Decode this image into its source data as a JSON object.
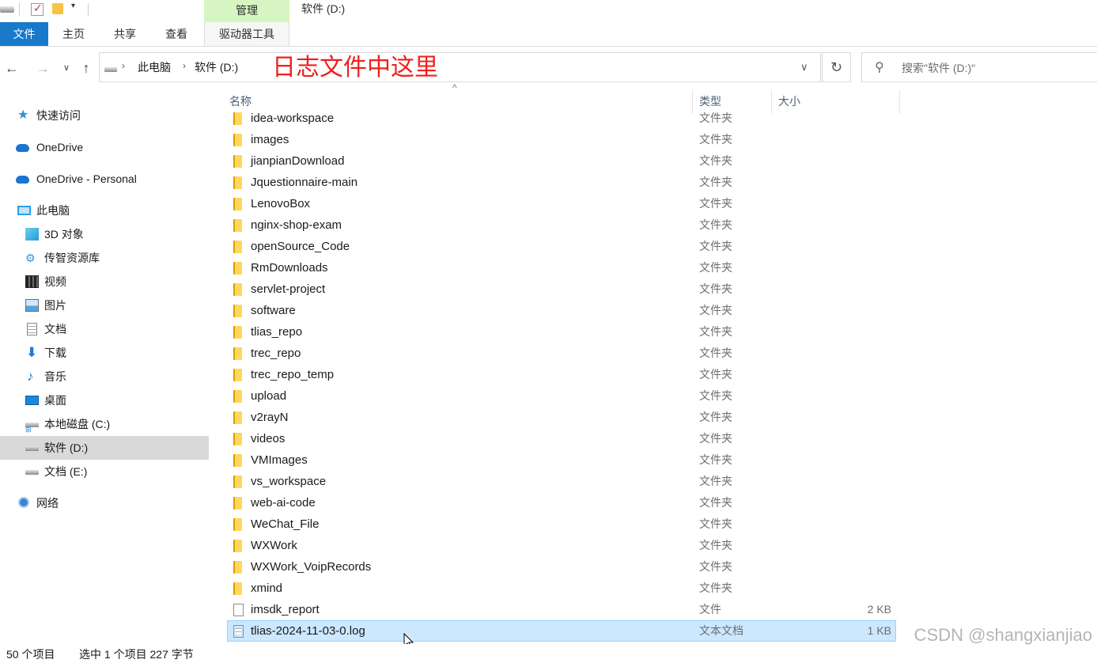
{
  "titlebar": {
    "manage_tab": "管理",
    "window_title": "软件 (D:)"
  },
  "ribbon": {
    "tabs": {
      "file": "文件",
      "home": "主页",
      "share": "共享",
      "view": "查看",
      "drive_tools": "驱动器工具"
    },
    "file_tab_color": "#1979ca",
    "manage_color": "#d6f5c2"
  },
  "address": {
    "crumbs": [
      "此电脑",
      "软件 (D:)"
    ],
    "annotation": "日志文件中这里",
    "annotation_color": "#f01e1e"
  },
  "search": {
    "placeholder": "搜索\"软件 (D:)\""
  },
  "navpane": {
    "items": [
      {
        "label": "快速访问",
        "icon": "star-icon"
      },
      {
        "label": "OneDrive",
        "icon": "onedrive-cloud-icon"
      },
      {
        "label": "OneDrive - Personal",
        "icon": "onedrive-cloud-icon"
      },
      {
        "label": "此电脑",
        "icon": "computer-icon"
      },
      {
        "label": "3D 对象",
        "icon": "3d-objects-icon"
      },
      {
        "label": "传智资源库",
        "icon": "network-share-icon"
      },
      {
        "label": "视频",
        "icon": "video-icon"
      },
      {
        "label": "图片",
        "icon": "pictures-icon"
      },
      {
        "label": "文档",
        "icon": "documents-icon"
      },
      {
        "label": "下载",
        "icon": "download-icon"
      },
      {
        "label": "音乐",
        "icon": "music-icon"
      },
      {
        "label": "桌面",
        "icon": "desktop-icon"
      },
      {
        "label": "本地磁盘 (C:)",
        "icon": "system-drive-icon"
      },
      {
        "label": "软件 (D:)",
        "icon": "drive-icon"
      },
      {
        "label": "文档 (E:)",
        "icon": "drive-icon"
      },
      {
        "label": "网络",
        "icon": "network-icon"
      }
    ],
    "selected": "软件 (D:)"
  },
  "filelist": {
    "columns": {
      "name": "名称",
      "type": "类型",
      "size": "大小"
    },
    "rows": [
      {
        "name": "idea-workspace",
        "type": "文件夹",
        "size": "",
        "kind": "folder"
      },
      {
        "name": "images",
        "type": "文件夹",
        "size": "",
        "kind": "folder"
      },
      {
        "name": "jianpianDownload",
        "type": "文件夹",
        "size": "",
        "kind": "folder"
      },
      {
        "name": "Jquestionnaire-main",
        "type": "文件夹",
        "size": "",
        "kind": "folder"
      },
      {
        "name": "LenovoBox",
        "type": "文件夹",
        "size": "",
        "kind": "folder"
      },
      {
        "name": "nginx-shop-exam",
        "type": "文件夹",
        "size": "",
        "kind": "folder"
      },
      {
        "name": "openSource_Code",
        "type": "文件夹",
        "size": "",
        "kind": "folder"
      },
      {
        "name": "RmDownloads",
        "type": "文件夹",
        "size": "",
        "kind": "folder"
      },
      {
        "name": "servlet-project",
        "type": "文件夹",
        "size": "",
        "kind": "folder"
      },
      {
        "name": "software",
        "type": "文件夹",
        "size": "",
        "kind": "folder"
      },
      {
        "name": "tlias_repo",
        "type": "文件夹",
        "size": "",
        "kind": "folder"
      },
      {
        "name": "trec_repo",
        "type": "文件夹",
        "size": "",
        "kind": "folder"
      },
      {
        "name": "trec_repo_temp",
        "type": "文件夹",
        "size": "",
        "kind": "folder"
      },
      {
        "name": "upload",
        "type": "文件夹",
        "size": "",
        "kind": "folder"
      },
      {
        "name": "v2rayN",
        "type": "文件夹",
        "size": "",
        "kind": "folder"
      },
      {
        "name": "videos",
        "type": "文件夹",
        "size": "",
        "kind": "folder"
      },
      {
        "name": "VMImages",
        "type": "文件夹",
        "size": "",
        "kind": "folder"
      },
      {
        "name": "vs_workspace",
        "type": "文件夹",
        "size": "",
        "kind": "folder"
      },
      {
        "name": "web-ai-code",
        "type": "文件夹",
        "size": "",
        "kind": "folder"
      },
      {
        "name": "WeChat_File",
        "type": "文件夹",
        "size": "",
        "kind": "folder"
      },
      {
        "name": "WXWork",
        "type": "文件夹",
        "size": "",
        "kind": "folder"
      },
      {
        "name": "WXWork_VoipRecords",
        "type": "文件夹",
        "size": "",
        "kind": "folder"
      },
      {
        "name": "xmind",
        "type": "文件夹",
        "size": "",
        "kind": "folder"
      },
      {
        "name": "imsdk_report",
        "type": "文件",
        "size": "2 KB",
        "kind": "file"
      },
      {
        "name": "tlias-2024-11-03-0.log",
        "type": "文本文档",
        "size": "1 KB",
        "kind": "textfile",
        "selected": true
      }
    ]
  },
  "status": {
    "count": "50 个项目",
    "selected": "选中 1 个项目  227 字节"
  },
  "watermark": "CSDN @shangxianjiao"
}
